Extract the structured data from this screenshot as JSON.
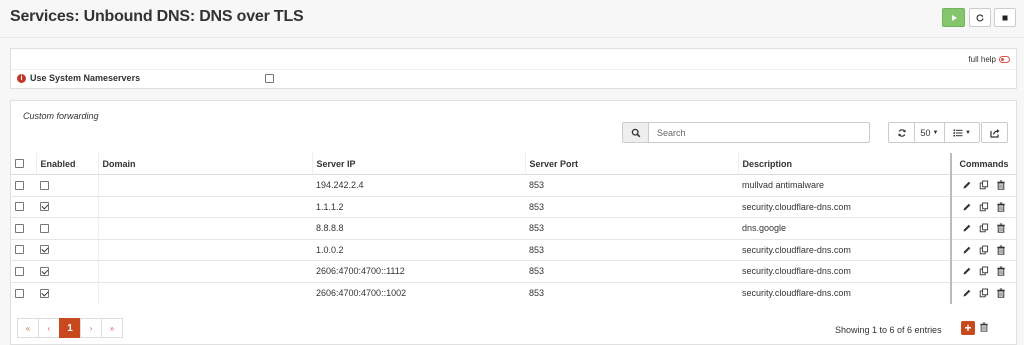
{
  "header": {
    "title": "Services: Unbound DNS: DNS over TLS"
  },
  "help": {
    "label": "full help"
  },
  "settings": {
    "use_system_nameservers_label": "Use System Nameservers",
    "use_system_nameservers_checked": false
  },
  "grid": {
    "title": "Custom forwarding",
    "search_placeholder": "Search",
    "page_size": "50",
    "columns": [
      "Enabled",
      "Domain",
      "Server IP",
      "Server Port",
      "Description",
      "Commands"
    ],
    "rows": [
      {
        "enabled": false,
        "domain": "",
        "server_ip": "194.242.2.4",
        "server_port": "853",
        "description": "mullvad antimalware"
      },
      {
        "enabled": true,
        "domain": "",
        "server_ip": "1.1.1.2",
        "server_port": "853",
        "description": "security.cloudflare-dns.com"
      },
      {
        "enabled": false,
        "domain": "",
        "server_ip": "8.8.8.8",
        "server_port": "853",
        "description": "dns.google"
      },
      {
        "enabled": true,
        "domain": "",
        "server_ip": "1.0.0.2",
        "server_port": "853",
        "description": "security.cloudflare-dns.com"
      },
      {
        "enabled": true,
        "domain": "",
        "server_ip": "2606:4700:4700::1112",
        "server_port": "853",
        "description": "security.cloudflare-dns.com"
      },
      {
        "enabled": true,
        "domain": "",
        "server_ip": "2606:4700:4700::1002",
        "server_port": "853",
        "description": "security.cloudflare-dns.com"
      }
    ],
    "pagination": {
      "first": "«",
      "prev": "‹",
      "current": "1",
      "next": "›",
      "last": "»"
    },
    "entries_text": "Showing 1 to 6 of 6 entries"
  },
  "colors": {
    "accent": "#c9491e",
    "play_green": "#84c56e",
    "info_red": "#c0392b"
  }
}
